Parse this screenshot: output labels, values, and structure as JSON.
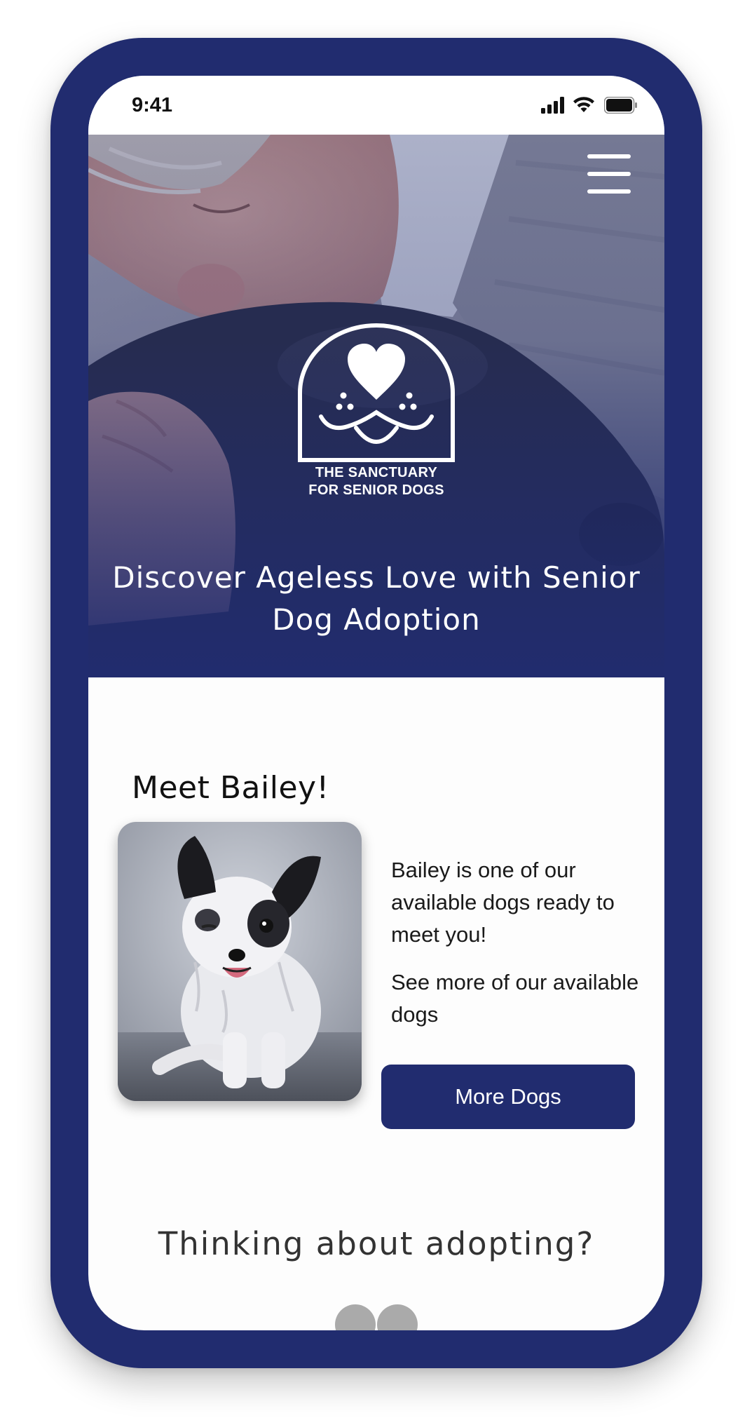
{
  "status_bar": {
    "time": "9:41",
    "icons": [
      "signal-icon",
      "wifi-icon",
      "battery-icon"
    ]
  },
  "hero": {
    "menu_icon": "hamburger-menu-icon",
    "logo_icon": "dog-face-heart-logo",
    "logo_text_line1": "THE SANCTUARY",
    "logo_text_line2": "FOR SENIOR DOGS",
    "title": "Discover Ageless Love with Senior Dog Adoption",
    "overlay_color": "#212c6f"
  },
  "meet": {
    "heading": "Meet Bailey!",
    "description": "Bailey is one of our available dogs ready to meet you!",
    "see_more": "See more of our available dogs",
    "button_label": "More Dogs"
  },
  "adopt": {
    "heading": "Thinking about adopting?"
  },
  "colors": {
    "brand_navy": "#212c6f",
    "text_dark": "#111111",
    "background": "#ffffff"
  }
}
